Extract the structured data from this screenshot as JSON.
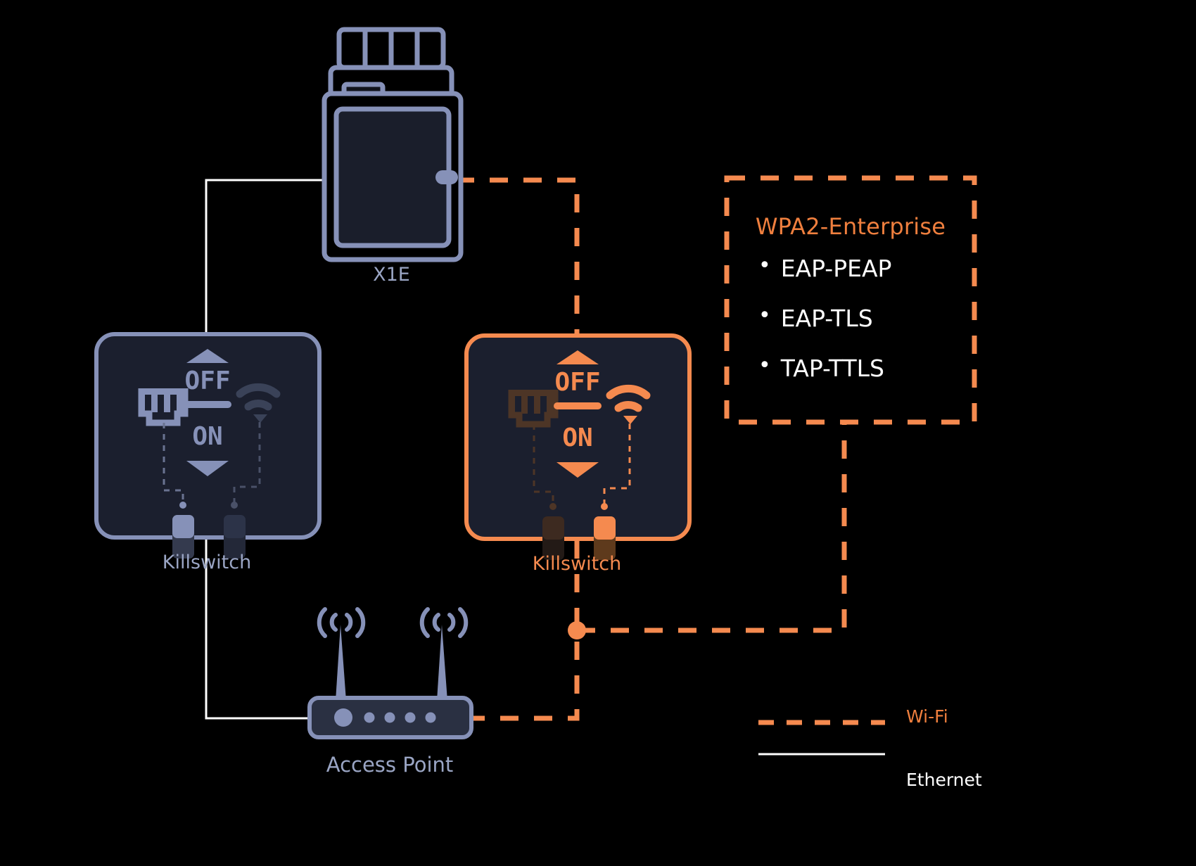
{
  "diagram": {
    "background_color": "#000000",
    "accent_wifi": "#f58a4f",
    "accent_ethernet": "#ffffff",
    "accent_device": "#8691b8",
    "nodes": {
      "x1e": {
        "label": "X1E"
      },
      "killswitch_left": {
        "label": "Killswitch",
        "off_text": "OFF",
        "on_text": "ON"
      },
      "killswitch_right": {
        "label": "Killswitch",
        "off_text": "OFF",
        "on_text": "ON"
      },
      "access_point": {
        "label": "Access Point"
      }
    },
    "wpa_box": {
      "title": "WPA2-Enterprise",
      "bullet": "•",
      "items": [
        "EAP-PEAP",
        "EAP-TLS",
        "TAP-TTLS"
      ]
    },
    "legend": {
      "wifi_label": "Wi-Fi",
      "ethernet_label": "Ethernet"
    }
  }
}
